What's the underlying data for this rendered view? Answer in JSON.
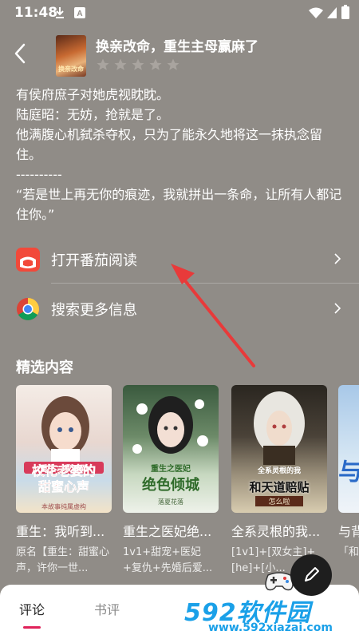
{
  "status_bar": {
    "time": "11:48"
  },
  "header": {
    "book_title": "换亲改命，重生主母赢麻了",
    "cover_text": "换亲改命"
  },
  "description": {
    "lines": [
      "有侯府庶子对她虎视眈眈。",
      "陆庭昭：无妨，抢就是了。",
      "他满腹心机弑杀夺权，只为了能永久地将这一抹执念留住。",
      "----------",
      "“若是世上再无你的痕迹，我就拼出一条命，让所有人都记住你。”"
    ]
  },
  "actions": [
    {
      "label": "打开番茄阅读",
      "icon": "fanqie-app-icon"
    },
    {
      "label": "搜索更多信息",
      "icon": "chrome-icon"
    }
  ],
  "section": {
    "title": "精选内容"
  },
  "cards": [
    {
      "title": "重生：我听到...",
      "intro": "原名【重生：甜蜜心声，许你一世...",
      "cover_line1": "校花老婆的",
      "cover_line2": "甜蜜心声",
      "cover_tag": "重生：我听到",
      "cover_author": "本故事纯属虚构"
    },
    {
      "title": "重生之医妃绝...",
      "intro": "1v1+甜宠+医妃+复仇+先婚后爱...",
      "cover_line1": "重生之医妃",
      "cover_line2": "绝色倾城",
      "cover_tag": "",
      "cover_author": "落夏花落"
    },
    {
      "title": "全系灵根的我...",
      "intro": "[1v1]+[双女主]+[he]+[小...",
      "cover_line1": "全系灵根的我",
      "cover_line2": "和天道赔贴",
      "cover_tag": "",
      "cover_author": "怎么啦"
    },
    {
      "title": "与背",
      "intro": "「和笔友",
      "cover_line1": "",
      "cover_line2": "与",
      "cover_tag": "",
      "cover_author": ""
    }
  ],
  "tabs": [
    {
      "label": "评论",
      "active": true
    },
    {
      "label": "书评",
      "active": false
    }
  ],
  "watermark": {
    "brand": "592软件园",
    "url": "www.592xiazai.com"
  },
  "colors": {
    "background": "#908c87",
    "accent": "#e0225a",
    "watermark": "#1aa0e8"
  }
}
